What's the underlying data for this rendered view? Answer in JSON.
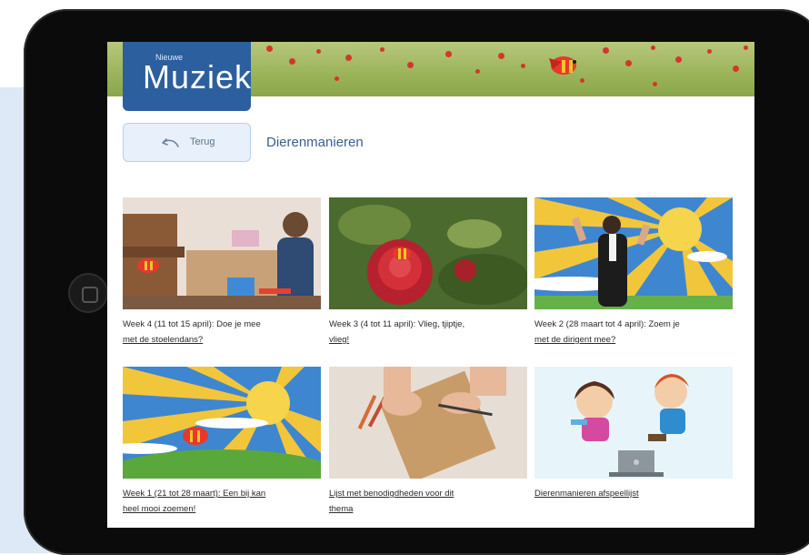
{
  "site": {
    "logo_small": "Nieuwe",
    "logo_big": "Muziek"
  },
  "nav": {
    "back_label": "Terug",
    "page_title": "Dierenmanieren"
  },
  "cards": [
    {
      "line1": "Week 4 (11 tot 15 april): Doe je mee",
      "line2": "met de stoelendans?"
    },
    {
      "line1": "Week 3 (4 tot 11 april): Vlieg, tjiptje,",
      "line2": "vlieg!"
    },
    {
      "line1": "Week 2 (28 maart tot 4 april): Zoem je",
      "line2": "met de dirigent mee?"
    },
    {
      "line1": "Week 1 (21 tot 28 maart): Een bij kan",
      "line2": "heel mooi zoemen!"
    },
    {
      "line1": "Lijst met benodigdheden voor dit",
      "line2": "thema"
    },
    {
      "line1": "Dierenmanieren afspeellijst",
      "line2": ""
    }
  ],
  "colors": {
    "logo_bg": "#2c5f9e",
    "back_button_bg": "#e8f1fb",
    "title_text": "#3a5f8c"
  }
}
